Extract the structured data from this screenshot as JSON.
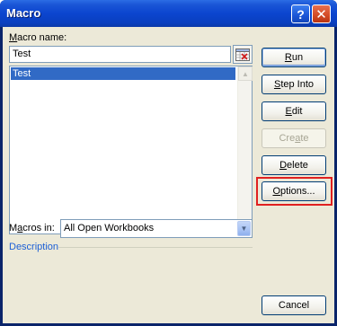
{
  "window": {
    "title": "Macro"
  },
  "title_buttons": {
    "help": "?",
    "close": "✕"
  },
  "macro_name": {
    "label_prefix": "",
    "label_mnemonic": "M",
    "label_rest": "acro name:",
    "value": "Test"
  },
  "macro_list": {
    "items": [
      "Test"
    ],
    "selected_index": 0
  },
  "buttons": {
    "run": {
      "mn": "R",
      "rest": "un"
    },
    "step_into": {
      "mn": "S",
      "rest": "tep Into"
    },
    "edit": {
      "mn": "E",
      "rest": "dit"
    },
    "create": {
      "pre": "Cre",
      "mn": "a",
      "rest": "te"
    },
    "delete": {
      "mn": "D",
      "rest": "elete"
    },
    "options": {
      "mn": "O",
      "rest": "ptions..."
    },
    "cancel": "Cancel"
  },
  "macros_in": {
    "label_pre": "M",
    "label_mnemonic": "a",
    "label_rest": "cros in:",
    "value": "All Open Workbooks"
  },
  "description": {
    "label": "Description"
  },
  "icons": {
    "help": "question-mark",
    "close": "x",
    "picker": "range-selector",
    "scroll_up": "up-arrow",
    "scroll_down": "down-arrow",
    "combo": "down-arrow"
  },
  "colors": {
    "title_bar": "#0b45cf",
    "selection": "#316ac5",
    "highlight_box": "#e02020",
    "dialog_face": "#ece9d8",
    "description_label": "#1c5fd6"
  }
}
